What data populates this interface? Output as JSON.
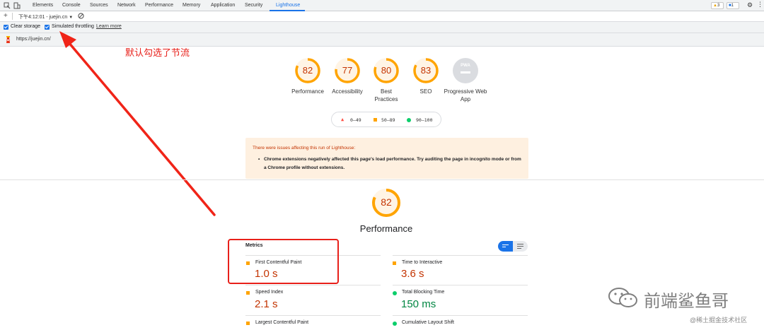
{
  "devtools": {
    "tabs": [
      "Elements",
      "Console",
      "Sources",
      "Network",
      "Performance",
      "Memory",
      "Application",
      "Security",
      "Lighthouse"
    ],
    "active_tab": "Lighthouse",
    "warnings_count": "3",
    "messages_count": "1"
  },
  "report_selector": {
    "label": "下午4:12:01 - juejin.cn",
    "add_symbol": "+"
  },
  "options": {
    "clear_storage": "Clear storage",
    "simulated_throttling": "Simulated throttling",
    "learn_more": "Learn more"
  },
  "url": "https://juejin.cn/",
  "annotation": "默认勾选了节流",
  "categories": [
    {
      "label": "Performance",
      "score": "82"
    },
    {
      "label": "Accessibility",
      "score": "77"
    },
    {
      "label": "Best Practices",
      "score": "80"
    },
    {
      "label": "SEO",
      "score": "83"
    },
    {
      "label": "Progressive Web App",
      "score": "PWA"
    }
  ],
  "legend": {
    "low": "0–49",
    "mid": "50–89",
    "high": "90–100"
  },
  "warning": {
    "title": "There were issues affecting this run of Lighthouse:",
    "item": "Chrome extensions negatively affected this page's load performance. Try auditing the page in incognito mode or from a Chrome profile without extensions."
  },
  "performance": {
    "score": "82",
    "title": "Performance"
  },
  "metrics": {
    "heading": "Metrics",
    "items": [
      {
        "label": "First Contentful Paint",
        "value": "1.0 s",
        "status": "average"
      },
      {
        "label": "Time to Interactive",
        "value": "3.6 s",
        "status": "average"
      },
      {
        "label": "Speed Index",
        "value": "2.1 s",
        "status": "average"
      },
      {
        "label": "Total Blocking Time",
        "value": "150 ms",
        "status": "pass"
      },
      {
        "label": "Largest Contentful Paint",
        "value": "",
        "status": "average"
      },
      {
        "label": "Cumulative Layout Shift",
        "value": "",
        "status": "pass"
      }
    ]
  },
  "watermark": {
    "brand": "前端鲨鱼哥",
    "site": "@稀土掘金技术社区"
  },
  "colors": {
    "accent": "#1a73e8",
    "orange": "#ffa400",
    "orange_text": "#c33300",
    "green": "#0cce6b",
    "green_text": "#018642",
    "red": "#ff4e42",
    "annotation": "#e8201a"
  }
}
